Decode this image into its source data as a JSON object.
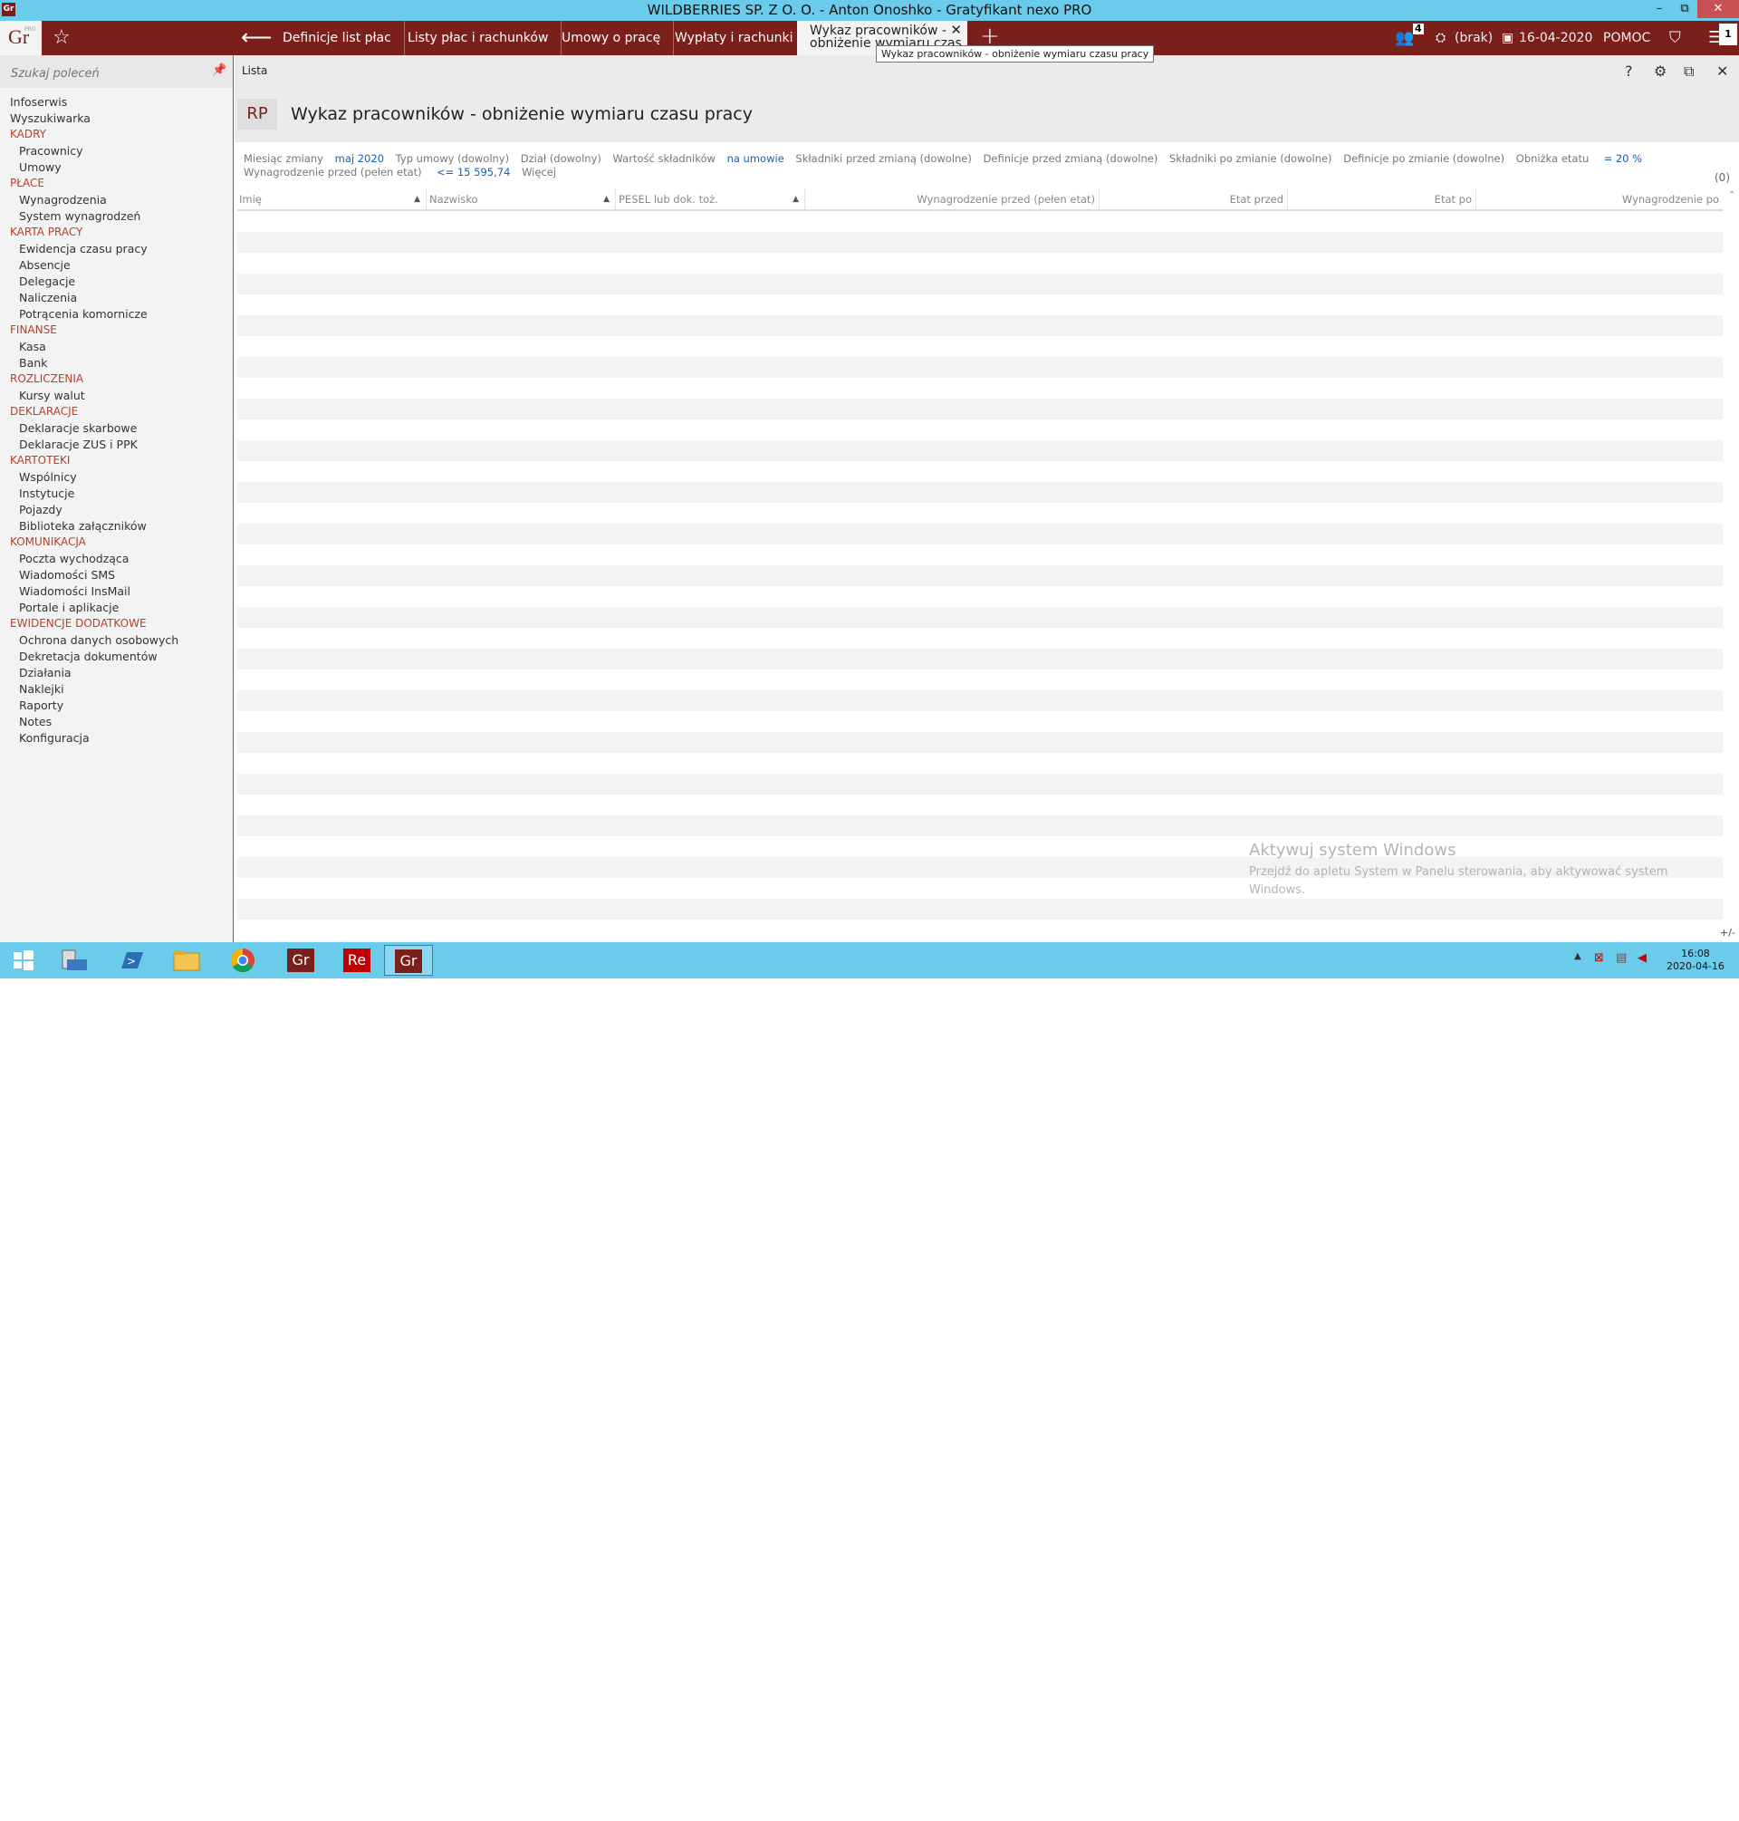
{
  "window": {
    "title": "WILDBERRIES SP. Z O. O. - Anton Onoshko - Gratyfikant nexo PRO",
    "app_icon": "Gr",
    "minimize": "–",
    "maximize": "⧉",
    "close": "✕"
  },
  "appbar": {
    "logo": "Gr",
    "logo_sup": "PRO",
    "tabs": [
      "Definicje list płac",
      "Listy płac i rachunków",
      "Umowy o pracę",
      "Wypłaty i rachunki"
    ],
    "active_tab_line1": "Wykaz pracowników -",
    "active_tab_line2": "obniżenie wymiaru czas",
    "users_count": "4",
    "brak": "(brak)",
    "date": "16-04-2020",
    "help": "POMOC",
    "notifications": "1"
  },
  "tooltip": "Wykaz pracowników - obniżenie wymiaru czasu pracy",
  "sidebar": {
    "search_placeholder": "Szukaj poleceń",
    "items": [
      {
        "type": "top",
        "label": "Infoserwis"
      },
      {
        "type": "top",
        "label": "Wyszukiwarka"
      },
      {
        "type": "group",
        "label": "KADRY"
      },
      {
        "type": "sub",
        "label": "Pracownicy"
      },
      {
        "type": "sub",
        "label": "Umowy"
      },
      {
        "type": "group",
        "label": "PŁACE"
      },
      {
        "type": "sub",
        "label": "Wynagrodzenia"
      },
      {
        "type": "sub",
        "label": "System wynagrodzeń"
      },
      {
        "type": "group",
        "label": "KARTA PRACY"
      },
      {
        "type": "sub",
        "label": "Ewidencja czasu pracy"
      },
      {
        "type": "sub",
        "label": "Absencje"
      },
      {
        "type": "sub",
        "label": "Delegacje"
      },
      {
        "type": "sub",
        "label": "Naliczenia"
      },
      {
        "type": "sub",
        "label": "Potrącenia komornicze"
      },
      {
        "type": "group",
        "label": "FINANSE"
      },
      {
        "type": "sub",
        "label": "Kasa"
      },
      {
        "type": "sub",
        "label": "Bank"
      },
      {
        "type": "group",
        "label": "ROZLICZENIA"
      },
      {
        "type": "sub",
        "label": "Kursy walut"
      },
      {
        "type": "group",
        "label": "DEKLARACJE"
      },
      {
        "type": "sub",
        "label": "Deklaracje skarbowe"
      },
      {
        "type": "sub",
        "label": "Deklaracje ZUS i PPK"
      },
      {
        "type": "group",
        "label": "KARTOTEKI"
      },
      {
        "type": "sub",
        "label": "Wspólnicy"
      },
      {
        "type": "sub",
        "label": "Instytucje"
      },
      {
        "type": "sub",
        "label": "Pojazdy"
      },
      {
        "type": "sub",
        "label": "Biblioteka załączników"
      },
      {
        "type": "group",
        "label": "KOMUNIKACJA"
      },
      {
        "type": "sub",
        "label": "Poczta wychodząca"
      },
      {
        "type": "sub",
        "label": "Wiadomości SMS"
      },
      {
        "type": "sub",
        "label": "Wiadomości InsMail"
      },
      {
        "type": "sub",
        "label": "Portale i aplikacje"
      },
      {
        "type": "group",
        "label": "EWIDENCJE DODATKOWE"
      },
      {
        "type": "sub",
        "label": "Ochrona danych osobowych"
      },
      {
        "type": "sub",
        "label": "Dekretacja dokumentów"
      },
      {
        "type": "sub",
        "label": "Działania"
      },
      {
        "type": "sub",
        "label": "Naklejki"
      },
      {
        "type": "sub",
        "label": "Raporty"
      },
      {
        "type": "sub",
        "label": "Notes"
      },
      {
        "type": "sub",
        "label": "Konfiguracja"
      }
    ]
  },
  "main": {
    "breadcrumb": "Lista",
    "header_icons": {
      "help": "?",
      "settings": "⚙",
      "restore": "⧉",
      "close": "✕"
    },
    "badge": "RP",
    "title": "Wykaz pracowników - obniżenie wymiaru czasu pracy",
    "filters": {
      "miesiac_label": "Miesiąc zmiany",
      "miesiac_value": "maj 2020",
      "typ_umowy": "Typ umowy (dowolny)",
      "dzial": "Dział (dowolny)",
      "wartosc_label": "Wartość składników",
      "wartosc_value": "na umowie",
      "skladniki_przed": "Składniki przed zmianą (dowolne)",
      "definicje_przed": "Definicje przed zmianą (dowolne)",
      "skladniki_po": "Składniki po zmianie (dowolne)",
      "definicje_po": "Definicje po zmianie (dowolne)",
      "obnizka_label": "Obniżka etatu",
      "obnizka_value": "= 20 %",
      "wynagrodzenie_label": "Wynagrodzenie przed (pełen etat)",
      "wynagrodzenie_value": "<= 15 595,74",
      "wiecej": "Więcej"
    },
    "count": "(0)",
    "columns": [
      "Imię",
      "Nazwisko",
      "PESEL lub dok. toż.",
      "Wynagrodzenie przed (pełen etat)",
      "Etat przed",
      "Etat po",
      "Wynagrodzenie po"
    ],
    "plus_minus": "+/-"
  },
  "watermark": {
    "title": "Aktywuj system Windows",
    "text": "Przejdź do apletu System w Panelu sterowania, aby aktywować system Windows."
  },
  "taskbar": {
    "gr1": "Gr",
    "re": "Re",
    "gr2": "Gr",
    "time": "16:08",
    "date": "2020-04-16"
  }
}
